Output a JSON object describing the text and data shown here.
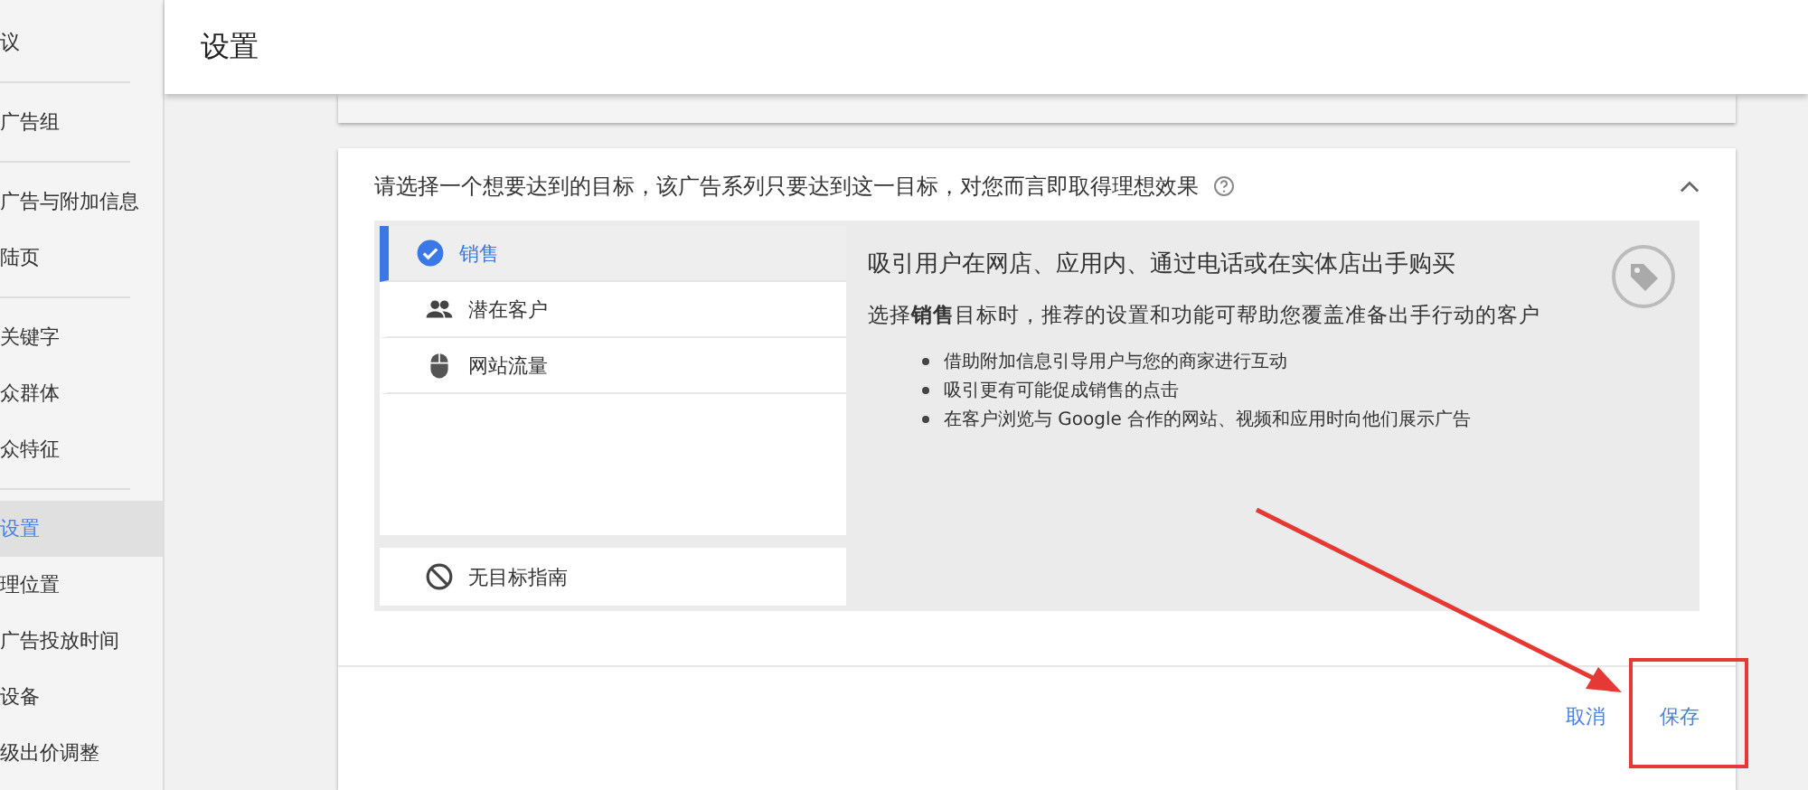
{
  "sidebar": {
    "groups": [
      {
        "items": [
          {
            "label": "议",
            "selected": false
          }
        ]
      },
      {
        "items": [
          {
            "label": "广告组",
            "selected": false
          }
        ]
      },
      {
        "items": [
          {
            "label": "广告与附加信息",
            "selected": false
          },
          {
            "label": "陆页",
            "selected": false
          }
        ]
      },
      {
        "items": [
          {
            "label": "关键字",
            "selected": false
          },
          {
            "label": "众群体",
            "selected": false
          },
          {
            "label": "众特征",
            "selected": false
          }
        ]
      },
      {
        "items": [
          {
            "label": "设置",
            "selected": true
          },
          {
            "label": "理位置",
            "selected": false
          },
          {
            "label": "广告投放时间",
            "selected": false
          },
          {
            "label": "设备",
            "selected": false
          },
          {
            "label": "级出价调整",
            "selected": false
          }
        ]
      }
    ]
  },
  "header": {
    "title": "设置"
  },
  "goal_card": {
    "question": "请选择一个想要达到的目标，该广告系列只要达到这一目标，对您而言即取得理想效果",
    "expanded": true,
    "goals": [
      {
        "label": "销售",
        "selected": true
      },
      {
        "label": "潜在客户",
        "selected": false
      },
      {
        "label": "网站流量",
        "selected": false
      }
    ],
    "no_goal": {
      "label": "无目标指南",
      "selected": false
    },
    "detail": {
      "title": "吸引用户在网店、应用内、通过电话或在实体店出手购买",
      "description": "选择**销售**目标时，推荐的设置和功能可帮助您覆盖准备出手行动的客户",
      "bullets": [
        "借助附加信息引导用户与您的商家进行互动",
        "吸引更有可能促成销售的点击",
        "在客户浏览与 Google 合作的网站、视频和应用时向他们展示广告"
      ]
    },
    "buttons": [
      "取消",
      "保存"
    ]
  }
}
